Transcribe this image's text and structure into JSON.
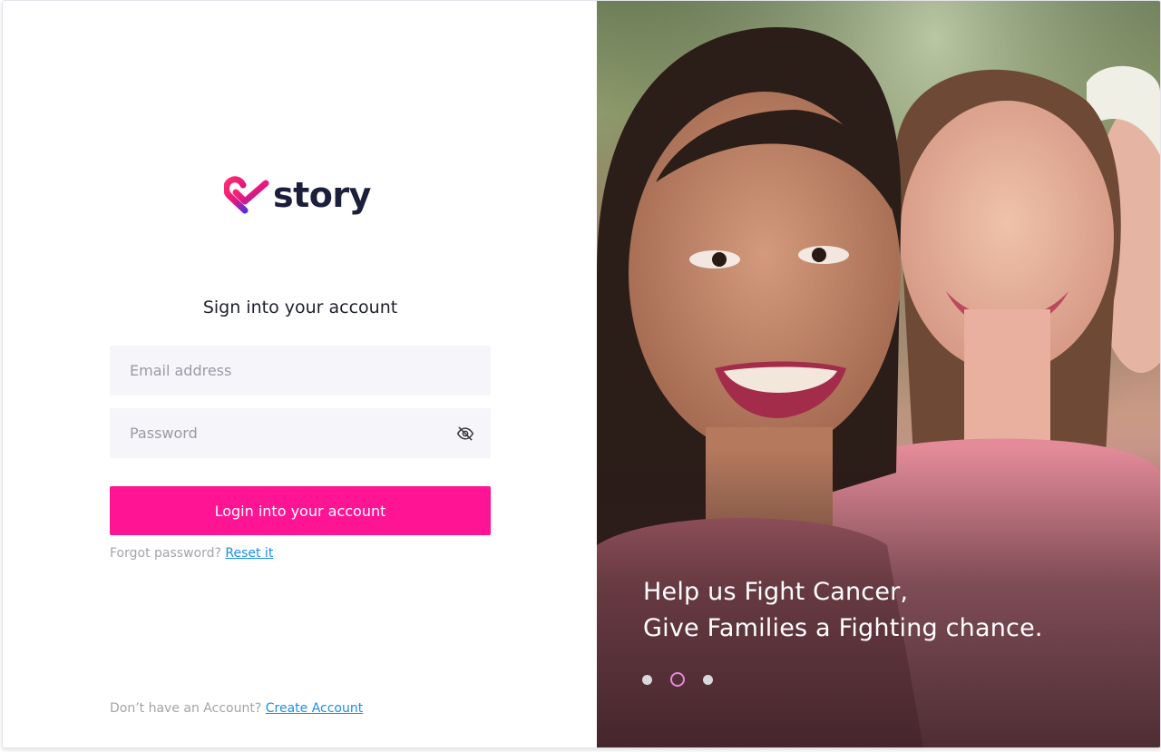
{
  "brand": {
    "name": "story",
    "colors": {
      "pink": "#ff1493",
      "navy": "#1c1f3b",
      "purple": "#5b2dd9"
    }
  },
  "login": {
    "title": "Sign into your account",
    "email_placeholder": "Email address",
    "password_placeholder": "Password",
    "eye_icon": "eye-off-icon",
    "submit_label": "Login into your account",
    "forgot_text": "Forgot password?",
    "reset_link": "Reset it",
    "signup_text": "Don’t have an Account?",
    "signup_link": "Create Account"
  },
  "hero": {
    "line1": "Help us Fight Cancer,",
    "line2": "Give Families a Fighting chance.",
    "slides": 3,
    "active_slide": 2
  }
}
